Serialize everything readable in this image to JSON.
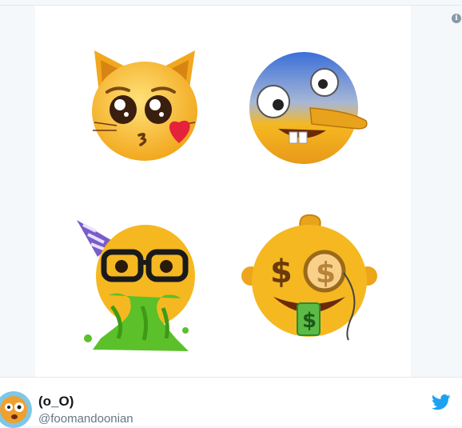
{
  "tweet": {
    "display_name": "(o_O)",
    "handle": "@foomandoonian"
  },
  "media": {
    "emojis": [
      "pleading-cat-kiss-emoji",
      "goofy-nose-face-emoji",
      "party-nerd-vomit-emoji",
      "money-monocle-emoji"
    ],
    "info_icon": "info-icon",
    "info_glyph": "i"
  },
  "colors": {
    "twitter_blue": "#1da1f2",
    "emoji_yellow": "#f5b820",
    "vomit_green": "#5cc02a"
  }
}
